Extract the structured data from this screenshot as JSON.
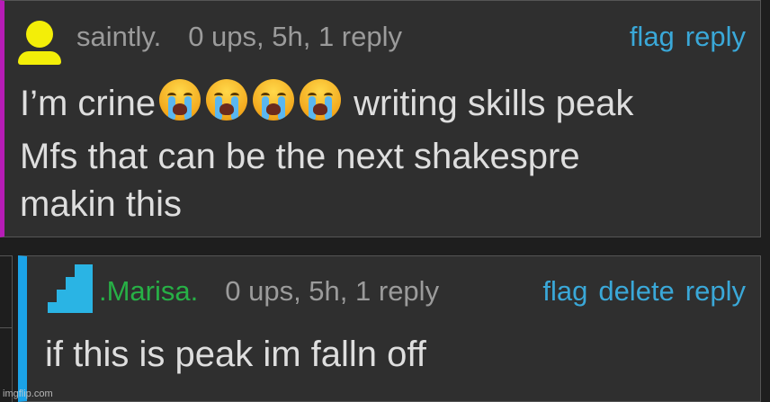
{
  "comment": {
    "username": "saintly.",
    "meta": "0 ups, 5h, 1 reply",
    "actions": [
      "flag",
      "reply"
    ],
    "body_line1_before_emoji": "I’m crine",
    "emoji": [
      "loudly-crying-face",
      "loudly-crying-face",
      "loudly-crying-face",
      "loudly-crying-face"
    ],
    "body_line1_after_emoji": "writing skills peak",
    "body_line2": "Mfs that can be the next shakespre",
    "body_line3": "makin this",
    "accent_color": "#b71cb7",
    "avatar_color": "#f3ee08"
  },
  "reply": {
    "username": ".Marisa.",
    "meta": "0 ups, 5h, 1 reply",
    "actions": [
      "flag",
      "delete",
      "reply"
    ],
    "body": "if this is peak im falln off",
    "accent_color": "#1ba3e8",
    "username_color": "#27b046"
  },
  "watermark": "imgflip.com"
}
